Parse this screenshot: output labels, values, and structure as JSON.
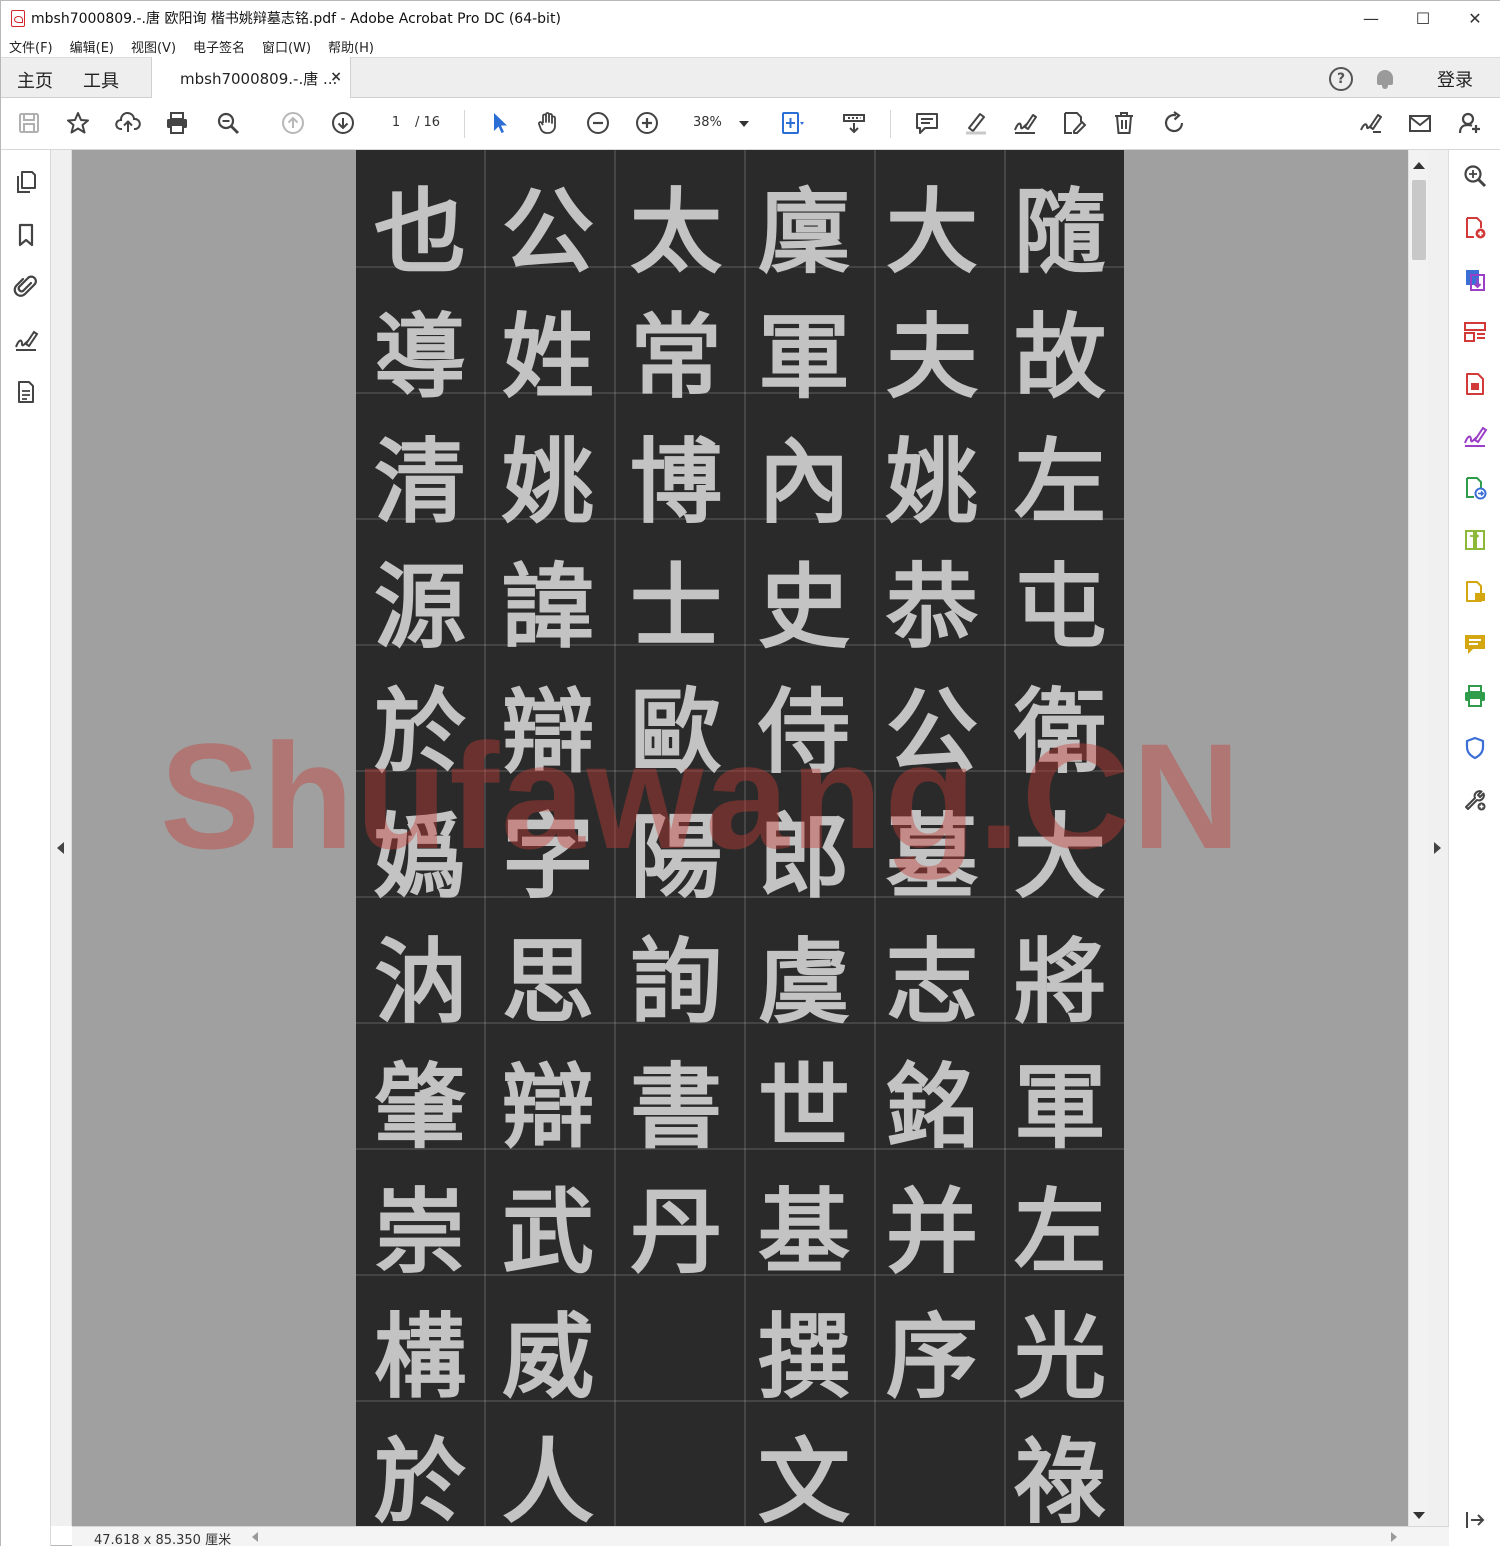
{
  "window": {
    "title": "mbsh7000809.-.唐 欧阳询 楷书姚辩墓志铭.pdf - Adobe Acrobat Pro DC (64-bit)",
    "minimize": "—",
    "maximize": "☐",
    "close": "✕"
  },
  "menubar": {
    "items": [
      "文件(F)",
      "编辑(E)",
      "视图(V)",
      "电子签名",
      "窗口(W)",
      "帮助(H)"
    ]
  },
  "tabs": {
    "home": "主页",
    "tools": "工具",
    "document": "mbsh7000809.-.唐 ...",
    "close": "×",
    "signin": "登录",
    "help": "?"
  },
  "toolbar": {
    "current_page": "1",
    "total_pages": "/ 16",
    "zoom": "38%",
    "icons": [
      "save-icon",
      "star-icon",
      "upload-icon",
      "print-icon",
      "zoom-search-icon",
      "page-up-icon",
      "page-down-icon",
      "select-cursor-icon",
      "hand-icon",
      "zoom-out-icon",
      "zoom-in-icon",
      "fit-page-icon",
      "read-mode-icon",
      "comment-icon",
      "highlight-icon",
      "sign-icon",
      "edit-text-icon",
      "delete-icon",
      "rotate-icon",
      "fill-sign-icon",
      "email-icon",
      "add-user-icon"
    ]
  },
  "left_nav": {
    "icons": [
      "pages-icon",
      "bookmark-icon",
      "attachment-icon",
      "signature-icon",
      "content-icon"
    ]
  },
  "document": {
    "columns": [
      [
        "隨",
        "故",
        "左",
        "屯",
        "衛",
        "大",
        "將",
        "軍",
        "左",
        "光",
        "祿"
      ],
      [
        "大",
        "夫",
        "姚",
        "恭",
        "公",
        "墓",
        "志",
        "銘",
        "并",
        "序"
      ],
      [
        "廩",
        "軍",
        "內",
        "史",
        "侍",
        "郎",
        "虞",
        "世",
        "基",
        "撰",
        "文"
      ],
      [
        "太",
        "常",
        "博",
        "士",
        "歐",
        "陽",
        "詢",
        "書",
        "丹"
      ],
      [
        "公",
        "姓",
        "姚",
        "諱",
        "辯",
        "字",
        "思",
        "辯",
        "武",
        "威",
        "人"
      ],
      [
        "也",
        "導",
        "清",
        "源",
        "於",
        "嬀",
        "汭",
        "肇",
        "崇",
        "構",
        "於"
      ]
    ],
    "watermark": "Shufawang.CN",
    "page_size": "47.618 x 85.350 厘米"
  },
  "right_pane": {
    "icons": [
      "enhance-scan-icon",
      "create-pdf-icon",
      "export-pdf-icon",
      "organize-pages-icon",
      "compress-pdf-icon",
      "fill-sign-tool-icon",
      "send-review-icon",
      "combine-files-icon",
      "share-icon",
      "comment-tool-icon",
      "print-production-icon",
      "protect-icon",
      "more-tools-icon",
      "collapse-pane-icon"
    ],
    "colors": {
      "red": "#d23a3a",
      "blue": "#3b6fd6",
      "purple": "#9b3fc7",
      "green": "#2e9c4a",
      "yellow": "#d4a60f",
      "gray": "#444444"
    }
  }
}
